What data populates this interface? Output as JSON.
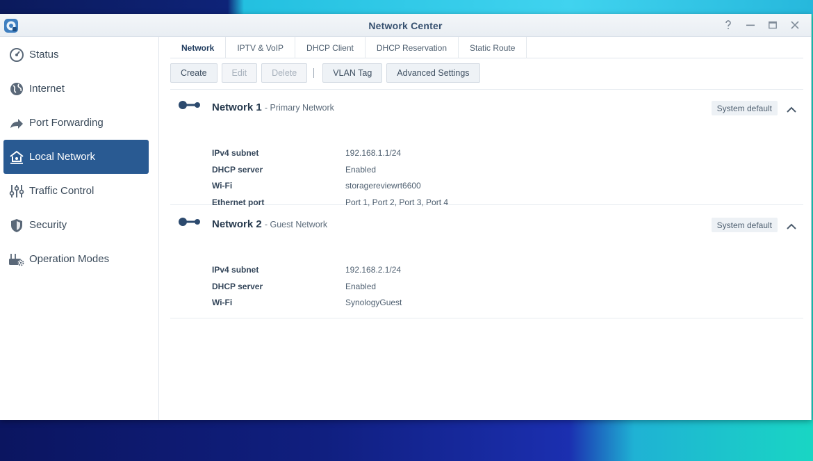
{
  "window": {
    "title": "Network Center"
  },
  "sidebar": {
    "items": [
      {
        "label": "Status",
        "icon": "gauge-icon"
      },
      {
        "label": "Internet",
        "icon": "globe-icon"
      },
      {
        "label": "Port Forwarding",
        "icon": "forward-arrow-icon"
      },
      {
        "label": "Local Network",
        "icon": "home-network-icon",
        "active": true
      },
      {
        "label": "Traffic Control",
        "icon": "sliders-icon"
      },
      {
        "label": "Security",
        "icon": "shield-icon"
      },
      {
        "label": "Operation Modes",
        "icon": "router-gear-icon"
      }
    ]
  },
  "tabs": [
    "Network",
    "IPTV & VoIP",
    "DHCP Client",
    "DHCP Reservation",
    "Static Route"
  ],
  "toolbar": {
    "create": "Create",
    "edit": "Edit",
    "delete": "Delete",
    "vlan_tag": "VLAN Tag",
    "advanced": "Advanced Settings"
  },
  "networks": [
    {
      "name": "Network 1",
      "subtitle": "- Primary Network",
      "badge": "System default",
      "fields": [
        {
          "label": "IPv4 subnet",
          "value": "192.168.1.1/24"
        },
        {
          "label": "DHCP server",
          "value": "Enabled"
        },
        {
          "label": "Wi-Fi",
          "value": "storagereviewrt6600"
        },
        {
          "label": "Ethernet port",
          "value": "Port 1, Port 2, Port 3, Port 4"
        }
      ]
    },
    {
      "name": "Network 2",
      "subtitle": "- Guest Network",
      "badge": "System default",
      "fields": [
        {
          "label": "IPv4 subnet",
          "value": "192.168.2.1/24"
        },
        {
          "label": "DHCP server",
          "value": "Enabled"
        },
        {
          "label": "Wi-Fi",
          "value": "SynologyGuest"
        }
      ]
    }
  ],
  "colors": {
    "sidebar_active": "#295a92",
    "title_text": "#36506f"
  }
}
